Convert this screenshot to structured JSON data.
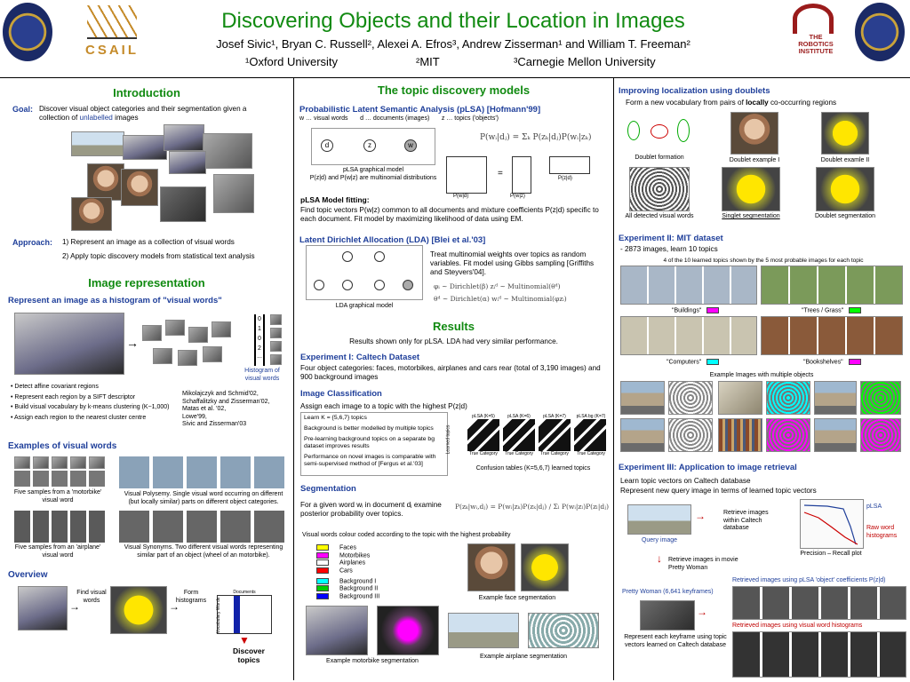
{
  "header": {
    "title": "Discovering Objects and their Location in Images",
    "authors": "Josef Sivic¹, Bryan C. Russell², Alexei A. Efros³, Andrew Zisserman¹ and William T. Freeman²",
    "affil1": "¹Oxford University",
    "affil2": "²MIT",
    "affil3": "³Carnegie Mellon University",
    "csail": "CSAIL",
    "robotics": "THE ROBOTICS INSTITUTE"
  },
  "col1": {
    "intro_title": "Introduction",
    "goal_label": "Goal:",
    "goal_text_a": "Discover visual object categories and their segmentation given a collection of",
    "goal_text_b": "unlabelled",
    "goal_text_c": "images",
    "approach_label": "Approach:",
    "approach_1": "1) Represent an image as a collection of visual words",
    "approach_2": "2) Apply topic discovery models from statistical text analysis",
    "imgrep_title": "Image representation",
    "histogram_heading": "Represent an image as a histogram of \"visual words\"",
    "hist_values": [
      "0",
      "1",
      "0",
      "2",
      "..."
    ],
    "hist_caption": "Histogram of visual words",
    "bullets": [
      "• Detect affine covariant regions",
      "• Represent each region by a SIFT descriptor",
      "• Build visual vocabulary by k-means clustering (K~1,000)",
      "• Assign each region to the nearest cluster centre"
    ],
    "refs": [
      "Mikolajczyk and Schmid'02,",
      "Schaffalitzky and Zisserman'02,",
      "Matas et al. '02,",
      "Lowe'99,",
      "Sivic and Zisserman'03"
    ],
    "examples_title": "Examples of visual words",
    "cap_moto": "Five samples from a 'motorbike' visual word",
    "cap_poly": "Visual Polysemy. Single visual word occurring on different (but locally similar) parts on different object categories.",
    "cap_air": "Five samples from an 'airplane' visual word",
    "cap_syn": "Visual Synonyms. Two different visual words representing similar part of an object  (wheel of an motorbike).",
    "overview_title": "Overview",
    "ov_find": "Find visual words",
    "ov_form": "Form histograms",
    "ov_docs": "Documents",
    "ov_vocab": "Vocabulary Words",
    "ov_discover": "Discover topics"
  },
  "col2": {
    "title": "The topic discovery models",
    "plsa_heading": "Probabilistic Latent Semantic Analysis (pLSA)  [Hofmann'99]",
    "plsa_vars": "w … visual words       d … documents (images)       z … topics ('objects')",
    "plsa_eq": "P(wᵢ|dⱼ) = Σₖ P(zₖ|dⱼ)P(wᵢ|zₖ)",
    "plsa_cap1": "pLSA graphical model",
    "plsa_cap2": "P(z|d) and P(w|z) are multinomial distributions",
    "node_d": "d",
    "node_z": "z",
    "node_w": "w",
    "mat_pwd": "P(w|d)",
    "mat_pwz": "P(w|z)",
    "mat_pzd": "P(z|d)",
    "fit_title": "pLSA Model fitting:",
    "fit_text": "Find topic vectors P(w|z) common to all documents and mixture coefficients P(z|d) specific to each document. Fit model by maximizing likelihood of data using EM.",
    "lda_heading": "Latent Dirichlet Allocation (LDA)  [Blei et al.'03]",
    "lda_text": "Treat multinomial weights over topics as random variables. Fit model using Gibbs sampling [Griffiths and Steyvers'04].",
    "lda_eq1": "φᵢ  ~  Dirichlet(β)     zᵢᵈ  ~  Multinomial(θᵈ)",
    "lda_eq2": "θᵈ  ~  Dirichlet(α)     wᵢᵈ  ~  Multinomial(φzᵢ)",
    "lda_cap": "LDA graphical model",
    "results_title": "Results",
    "results_sub": "Results shown only for pLSA. LDA had very similar performance.",
    "exp1_heading": "Experiment I: Caltech Dataset",
    "exp1_text": "Four object categories: faces, motorbikes, airplanes and cars rear (total of 3,190 images) and 900 background images",
    "cls_heading": "Image Classification",
    "cls_text": "Assign each image to a topic with the highest P(z|d)",
    "cls_points": [
      "Learn K = {5,6,7} topics",
      "Background is better modelled by multiple topics",
      "Pre-learning background topics on a separate bg dataset improves results",
      "Performance on novel images is comparable with semi-supervised method of [Fergus et al.'03]"
    ],
    "conf_titles": [
      "pLSA (K=5)",
      "pLSA (K=6)",
      "pLSA (K=7)",
      "pLSA bg (K=7)"
    ],
    "conf_ylabel": "Learned topics",
    "conf_xlabel": "True Category",
    "conf_cap": "Confusion tables (K=5,6,7) learned topics",
    "seg_heading": "Segmentation",
    "seg_text": "For a given word wᵢ in document dⱼ examine posterior probability over topics.",
    "seg_eq": "P(zₖ|wᵢ,dⱼ) = P(wᵢ|zₖ)P(zₖ|dⱼ) / Σₗ P(wᵢ|zₗ)P(zₗ|dⱼ)",
    "colour_caption": "Visual words colour coded according to the topic with the highest probability",
    "legend": [
      {
        "label": "Faces",
        "color": "#ffff00"
      },
      {
        "label": "Motorbikes",
        "color": "#ff00ff"
      },
      {
        "label": "Airplanes",
        "color": "#ffffff"
      },
      {
        "label": "Cars",
        "color": "#ff0000"
      },
      {
        "label": "Background I",
        "color": "#00ffff"
      },
      {
        "label": "Background II",
        "color": "#00cc00"
      },
      {
        "label": "Background III",
        "color": "#0000ff"
      }
    ],
    "cap_face": "Example face segmentation",
    "cap_moto": "Example motorbike segmentation",
    "cap_air": "Example airplane segmentation"
  },
  "col3": {
    "doublet_heading": "Improving localization using doublets",
    "doublet_text_a": "Form a new vocabulary from pairs of",
    "doublet_text_b": "locally",
    "doublet_text_c": "co-occurring regions",
    "cap_form": "Doublet formation",
    "cap_ex1": "Doublet example I",
    "cap_ex2": "Doublet examle II",
    "cap_all": "All detected visual words",
    "cap_single": "Singlet segmentation",
    "cap_dseg": "Doublet segmentation",
    "exp2_heading": "Experiment II: MIT dataset",
    "exp2_text": "- 2873 images, learn 10 topics",
    "exp2_sub": "4 of the 10 learned topics shown by the 5 most probable images for each topic",
    "topic_buildings": "\"Buildings\"",
    "topic_trees": "\"Trees / Grass\"",
    "topic_computers": "\"Computers\"",
    "topic_bookshelves": "\"Bookshelves\"",
    "color_buildings": "#ff00ff",
    "color_trees": "#00ff00",
    "color_computers": "#00ffff",
    "color_bookshelves": "#ff00ff",
    "multi_cap": "Example Images with multiple objects",
    "exp3_heading": "Experiment III: Application to image retrieval",
    "exp3_l1": "Learn topic vectors on Caltech database",
    "exp3_l2": "Represent new query image in terms of learned topic vectors",
    "query_cap": "Query image",
    "retr_caltech": "Retrieve images within Caltech database",
    "retr_movie": "Retrieve images in movie Pretty Woman",
    "pr_plsa": "pLSA",
    "pr_raw": "Raw word histograms",
    "pr_cap": "Precision – Recall plot",
    "pw_cap": "Pretty Woman (6,641 keyframes)",
    "kf_text": "Represent each keyframe using topic vectors learned on Caltech database",
    "retr_plsa": "Retrieved images using pLSA 'object' coefficients P(z|d)",
    "retr_vw": "Retrieved images using visual word histograms"
  }
}
